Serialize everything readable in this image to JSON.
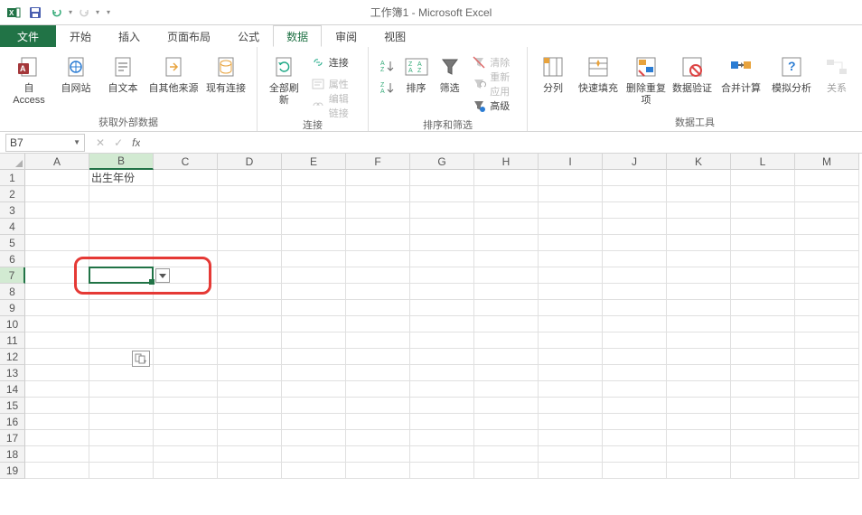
{
  "title": "工作簿1 - Microsoft Excel",
  "tabs": {
    "file": "文件",
    "home": "开始",
    "insert": "插入",
    "pagelayout": "页面布局",
    "formulas": "公式",
    "data": "数据",
    "review": "审阅",
    "view": "视图"
  },
  "ribbon": {
    "group_external": {
      "label": "获取外部数据",
      "access": "自 Access",
      "web": "自网站",
      "text": "自文本",
      "other": "自其他来源",
      "existing": "现有连接"
    },
    "group_conn": {
      "label": "连接",
      "refreshall": "全部刷新",
      "connections": "连接",
      "properties": "属性",
      "editlinks": "编辑链接"
    },
    "group_sort": {
      "label": "排序和筛选",
      "sort": "排序",
      "filter": "筛选",
      "clear": "清除",
      "reapply": "重新应用",
      "advanced": "高级"
    },
    "group_tools": {
      "label": "数据工具",
      "textcol": "分列",
      "flashfill": "快速填充",
      "removedup": "删除重复项",
      "validation": "数据验证",
      "consolidate": "合并计算",
      "whatif": "模拟分析",
      "relations": "关系"
    }
  },
  "namebox": "B7",
  "columns": [
    "A",
    "B",
    "C",
    "D",
    "E",
    "F",
    "G",
    "H",
    "I",
    "J",
    "K",
    "L",
    "M"
  ],
  "rows": [
    "1",
    "2",
    "3",
    "4",
    "5",
    "6",
    "7",
    "8",
    "9",
    "10",
    "11",
    "12",
    "13",
    "14",
    "15",
    "16",
    "17",
    "18",
    "19"
  ],
  "cells": {
    "B1": "出生年份"
  },
  "selection": {
    "col": 1,
    "row": 6
  }
}
